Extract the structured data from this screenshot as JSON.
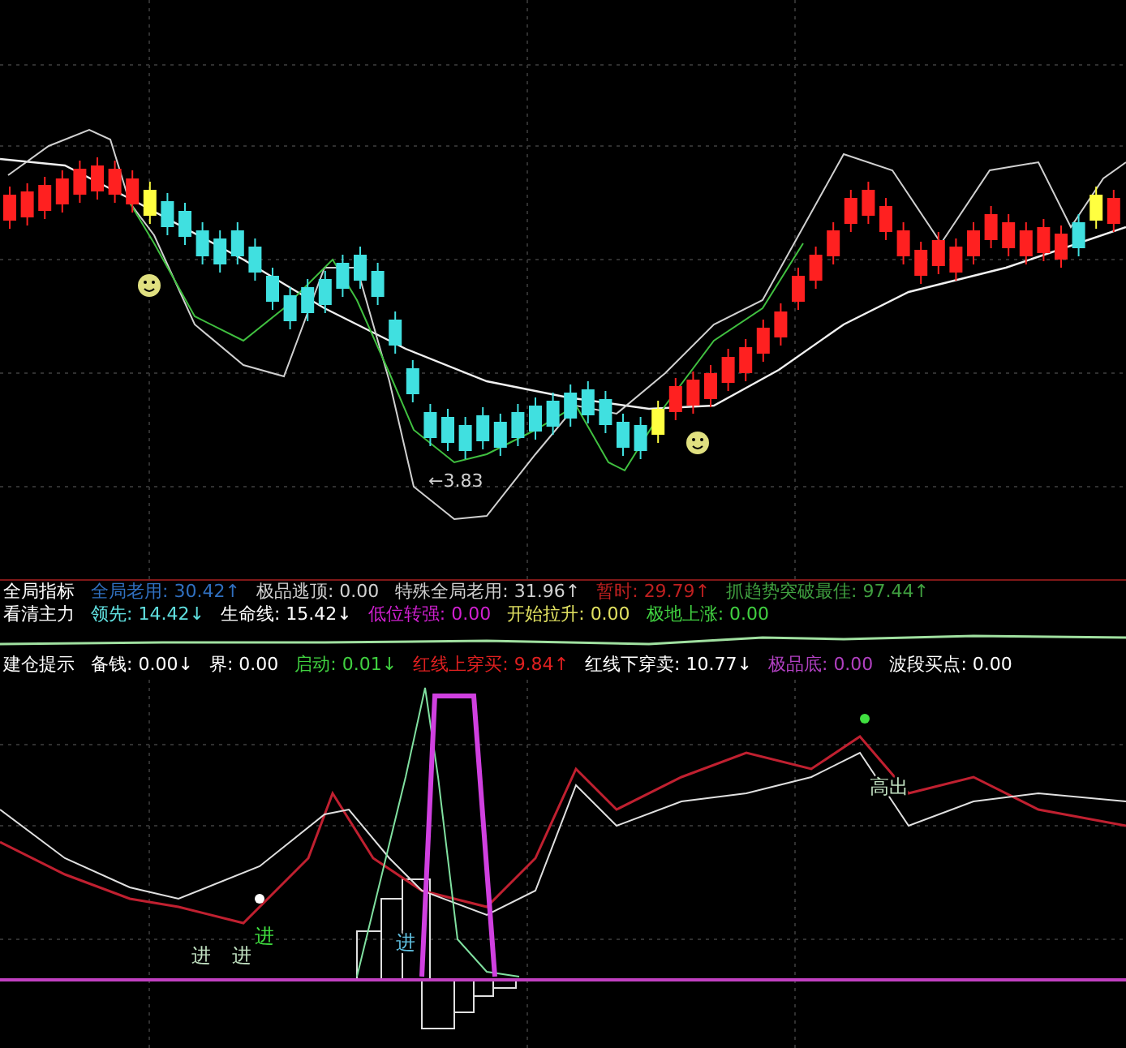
{
  "main_chart": {
    "price_label": "←3.83"
  },
  "indicator_rows": [
    {
      "title": "全局指标",
      "items": [
        {
          "label": "全局老用:",
          "value": "30.42",
          "arrow": "↑",
          "color": "#3070c0"
        },
        {
          "label": "极品逃顶:",
          "value": "0.00",
          "color": "#d0d0d0"
        },
        {
          "label": "特殊全局老用:",
          "value": "31.96",
          "arrow": "↑",
          "color": "#d0d0d0"
        },
        {
          "label": "暂时:",
          "value": "29.79",
          "arrow": "↑",
          "color": "#c02020"
        },
        {
          "label": "抓趋势突破最佳:",
          "value": "97.44",
          "arrow": "↑",
          "color": "#40a040"
        }
      ]
    },
    {
      "title": "看清主力",
      "items": [
        {
          "label": "领先:",
          "value": "14.42",
          "arrow": "↓",
          "color": "#60e0e0"
        },
        {
          "label": "生命线:",
          "value": "15.42",
          "arrow": "↓",
          "color": "#ffffff"
        },
        {
          "label": "低位转强:",
          "value": "0.00",
          "color": "#d020d0"
        },
        {
          "label": "开始拉升:",
          "value": "0.00",
          "color": "#e0e060"
        },
        {
          "label": "极地上涨:",
          "value": "0.00",
          "color": "#40d040"
        }
      ]
    },
    {
      "title": "建仓提示",
      "items": [
        {
          "label": "备钱:",
          "value": "0.00",
          "arrow": "↓",
          "color": "#ffffff"
        },
        {
          "label": "界:",
          "value": "0.00",
          "color": "#ffffff"
        },
        {
          "label": "启动:",
          "value": "0.01",
          "arrow": "↓",
          "color": "#40d040"
        },
        {
          "label": "红线上穿买:",
          "value": "9.84",
          "arrow": "↑",
          "color": "#e02020"
        },
        {
          "label": "红线下穿卖:",
          "value": "10.77",
          "arrow": "↓",
          "color": "#ffffff"
        },
        {
          "label": "极品底:",
          "value": "0.00",
          "color": "#b040c0"
        },
        {
          "label": "波段买点:",
          "value": "0.00",
          "color": "#ffffff"
        }
      ]
    }
  ],
  "lower_chart": {
    "markers": [
      {
        "text": "进",
        "color": "#c0e0c0"
      },
      {
        "text": "进",
        "color": "#c0e0c0"
      },
      {
        "text": "进",
        "color": "#40e040"
      },
      {
        "text": "进",
        "color": "#60c0e0"
      }
    ],
    "high_label": "高出"
  }
}
